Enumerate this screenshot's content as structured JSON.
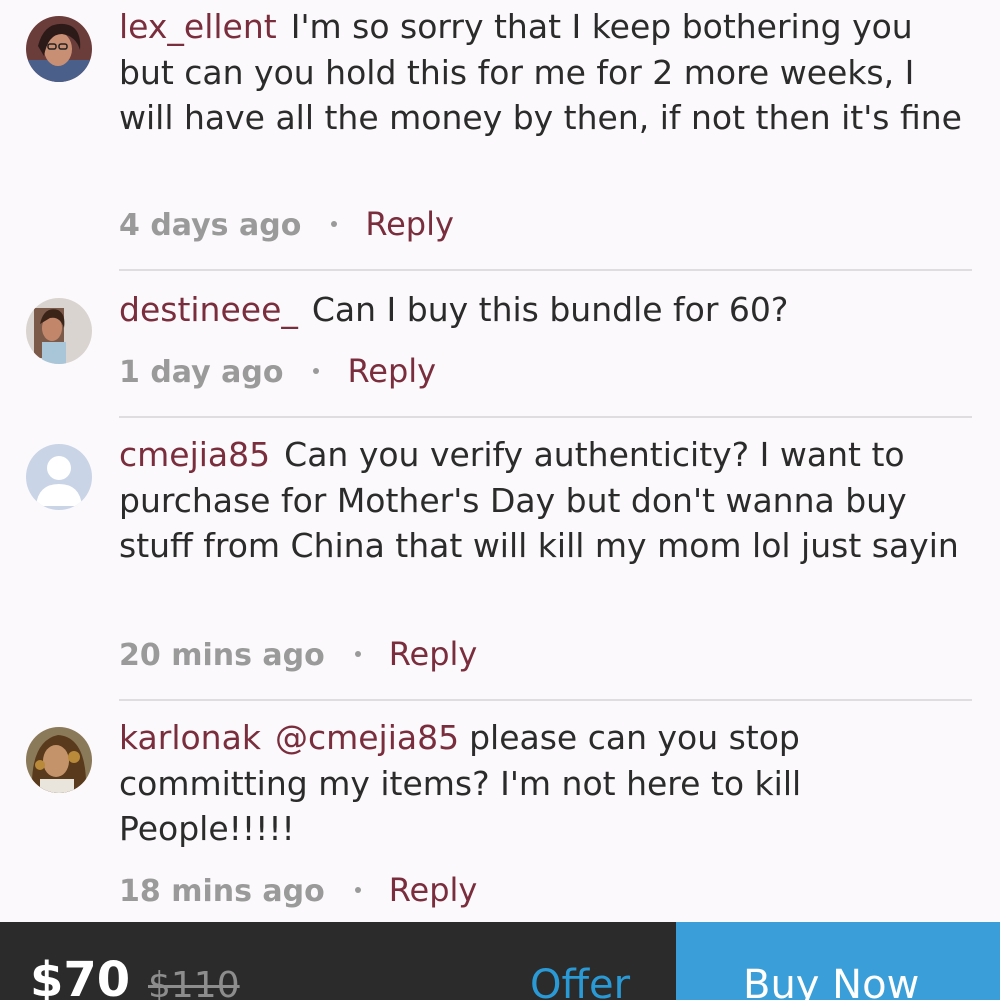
{
  "comments": [
    {
      "username": "lex_ellent",
      "mention": "",
      "text": "I'm so sorry that I keep bothering you but can you hold this for me for 2 more weeks, I will have all the money by then, if not then it's fine",
      "time": "4 days ago",
      "reply_label": "Reply",
      "avatar_icon": "user-photo-avatar"
    },
    {
      "username": "destineee_",
      "mention": "",
      "text": "Can I buy this bundle for 60?",
      "time": "1 day ago",
      "reply_label": "Reply",
      "avatar_icon": "user-photo-avatar"
    },
    {
      "username": "cmejia85",
      "mention": "",
      "text": "Can you verify authenticity? I want to purchase for Mother's Day but don't wanna buy stuff from China that will kill my mom lol just sayin",
      "time": "20 mins ago",
      "reply_label": "Reply",
      "avatar_icon": "default-user-icon"
    },
    {
      "username": "karlonak",
      "mention": "@cmejia85",
      "text": "please can you stop committing my items? I'm not here to kill People!!!!!",
      "time": "18 mins ago",
      "reply_label": "Reply",
      "avatar_icon": "user-photo-avatar"
    }
  ],
  "bottom_bar": {
    "price": "$70",
    "original_price": "$110",
    "offer_label": "Offer",
    "buy_now_label": "Buy Now"
  },
  "colors": {
    "background": "#fbf9fb",
    "username": "#7a2e3d",
    "body_text": "#2b2b2b",
    "muted": "#9a9a9a",
    "bottom_bar": "#2c2b2b",
    "buy_now": "#3a9fd8",
    "offer": "#2a9ad6"
  }
}
